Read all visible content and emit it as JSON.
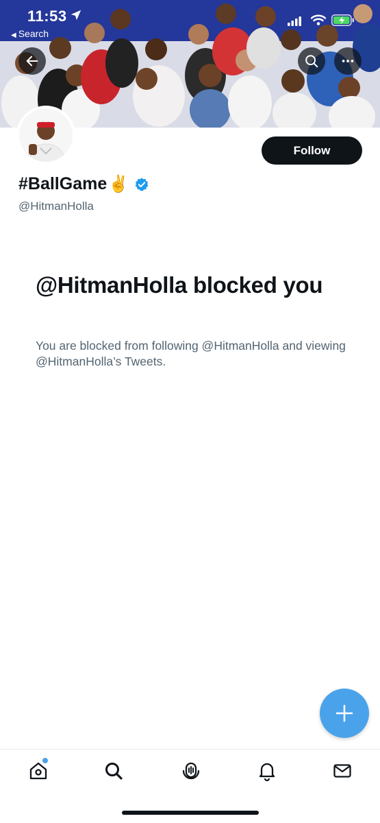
{
  "status_bar": {
    "time": "11:53",
    "back_label": "Search"
  },
  "profile": {
    "display_name": "#BallGame",
    "name_emoji": "✌️",
    "handle": "@HitmanHolla",
    "verified": true,
    "follow_label": "Follow"
  },
  "blocked": {
    "title": "@HitmanHolla blocked you",
    "description": "You are blocked from following @HitmanHolla and viewing @HitmanHolla’s Tweets."
  },
  "icons": {
    "back": "arrow-left-icon",
    "search": "search-icon",
    "more": "more-horizontal-icon",
    "fab": "plus-icon",
    "nav_home": "home-icon",
    "nav_search": "search-icon",
    "nav_spaces": "spaces-icon",
    "nav_notifications": "bell-icon",
    "nav_messages": "mail-icon"
  },
  "colors": {
    "accent": "#4aa3ea",
    "verified": "#1d9bf0",
    "text_primary": "#0f1419",
    "text_secondary": "#536471",
    "follow_bg": "#0f1419"
  }
}
